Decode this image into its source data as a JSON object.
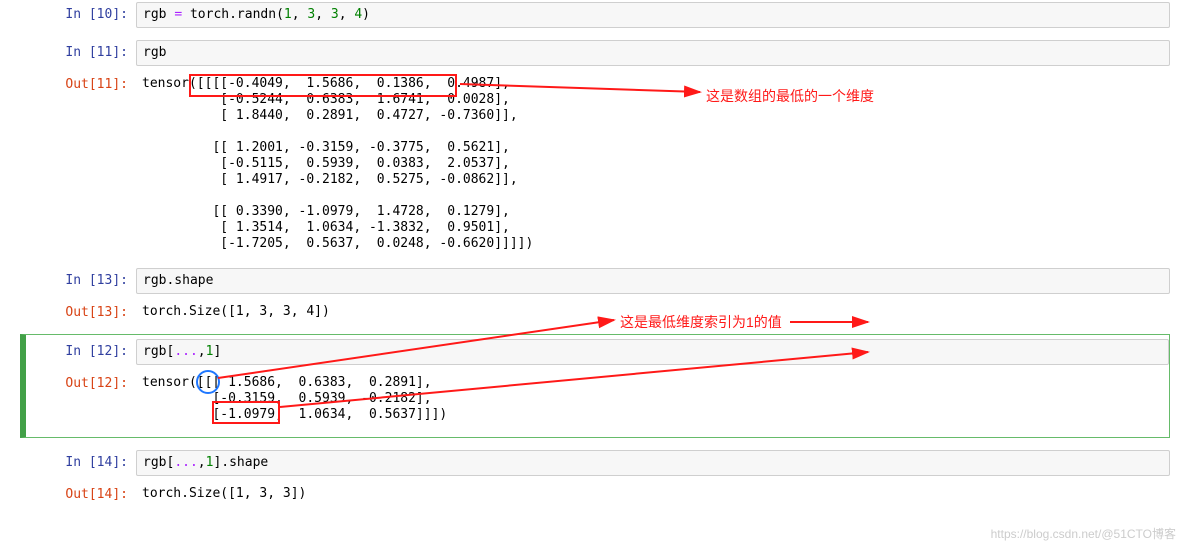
{
  "cells": {
    "in10_prompt": "In  [10]:",
    "in10_code": "rgb = torch.randn(1, 3, 3, 4)",
    "in11_prompt": "In  [11]:",
    "in11_code": "rgb",
    "out11_prompt": "Out[11]:",
    "out11_text": "tensor([[[[-0.4049,  1.5686,  0.1386,  0.4987],\n          [-0.5244,  0.6383,  1.6741,  0.0028],\n          [ 1.8440,  0.2891,  0.4727, -0.7360]],\n\n         [[ 1.2001, -0.3159, -0.3775,  0.5621],\n          [-0.5115,  0.5939,  0.0383,  2.0537],\n          [ 1.4917, -0.2182,  0.5275, -0.0862]],\n\n         [[ 0.3390, -1.0979,  1.4728,  0.1279],\n          [ 1.3514,  1.0634, -1.3832,  0.9501],\n          [-1.7205,  0.5637,  0.0248, -0.6620]]]])",
    "in13_prompt": "In  [13]:",
    "in13_code": "rgb.shape",
    "out13_prompt": "Out[13]:",
    "out13_text": "torch.Size([1, 3, 3, 4])",
    "in12_prompt": "In  [12]:",
    "in12_code": "rgb[...,1]",
    "out12_prompt": "Out[12]:",
    "out12_text": "tensor([[[ 1.5686,  0.6383,  0.2891],\n         [-0.3159,  0.5939, -0.2182],\n         [-1.0979,  1.0634,  0.5637]]])",
    "in14_prompt": "In  [14]:",
    "in14_code": "rgb[...,1].shape",
    "out14_prompt": "Out[14]:",
    "out14_text": "torch.Size([1, 3, 3])"
  },
  "annotations": {
    "top": "这是数组的最低的一个维度",
    "mid": "这是最低维度索引为1的值"
  },
  "watermark": "https://blog.csdn.net/@51CTO博客"
}
